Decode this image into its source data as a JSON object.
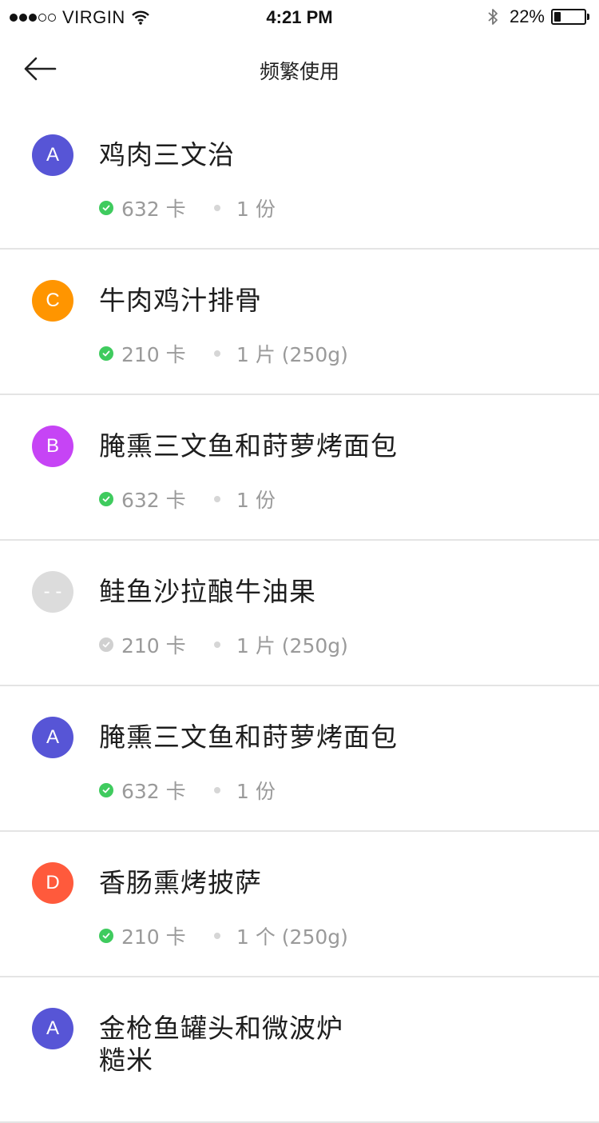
{
  "status_bar": {
    "signal_dots": [
      true,
      true,
      true,
      false,
      false
    ],
    "carrier": "VIRGIN",
    "time": "4:21 PM",
    "battery_pct": "22%",
    "battery_level": 0.22
  },
  "nav": {
    "title": "频繁使用",
    "back_icon": "arrow-left-icon"
  },
  "colors": {
    "check_active": "#3fcb5e",
    "check_inactive": "#d0d0d0",
    "divider": "#e4e4e4"
  },
  "items": [
    {
      "avatar": "A",
      "avatar_color": "#5755d6",
      "name": "鸡肉三文治",
      "calories": "632 卡",
      "portion": "1 份",
      "checked": true
    },
    {
      "avatar": "C",
      "avatar_color": "#ff9500",
      "name": "牛肉鸡汁排骨",
      "calories": "210 卡",
      "portion": "1 片 (250g)",
      "checked": true
    },
    {
      "avatar": "B",
      "avatar_color": "#c644f5",
      "name": "腌熏三文鱼和莳萝烤面包",
      "calories": "632 卡",
      "portion": "1 份",
      "checked": true
    },
    {
      "avatar": "- -",
      "avatar_color": "#dcdcdc",
      "name": "鲑鱼沙拉酿牛油果",
      "calories": "210 卡",
      "portion": "1 片 (250g)",
      "checked": false
    },
    {
      "avatar": "A",
      "avatar_color": "#5755d6",
      "name": "腌熏三文鱼和莳萝烤面包",
      "calories": "632 卡",
      "portion": "1 份",
      "checked": true
    },
    {
      "avatar": "D",
      "avatar_color": "#ff5a3c",
      "name": "香肠熏烤披萨",
      "calories": "210 卡",
      "portion": "1 个 (250g)",
      "checked": true
    },
    {
      "avatar": "A",
      "avatar_color": "#5755d6",
      "name": "金枪鱼罐头和微波炉",
      "name_line2": "糙米",
      "calories": "",
      "portion": "",
      "checked": true
    }
  ]
}
